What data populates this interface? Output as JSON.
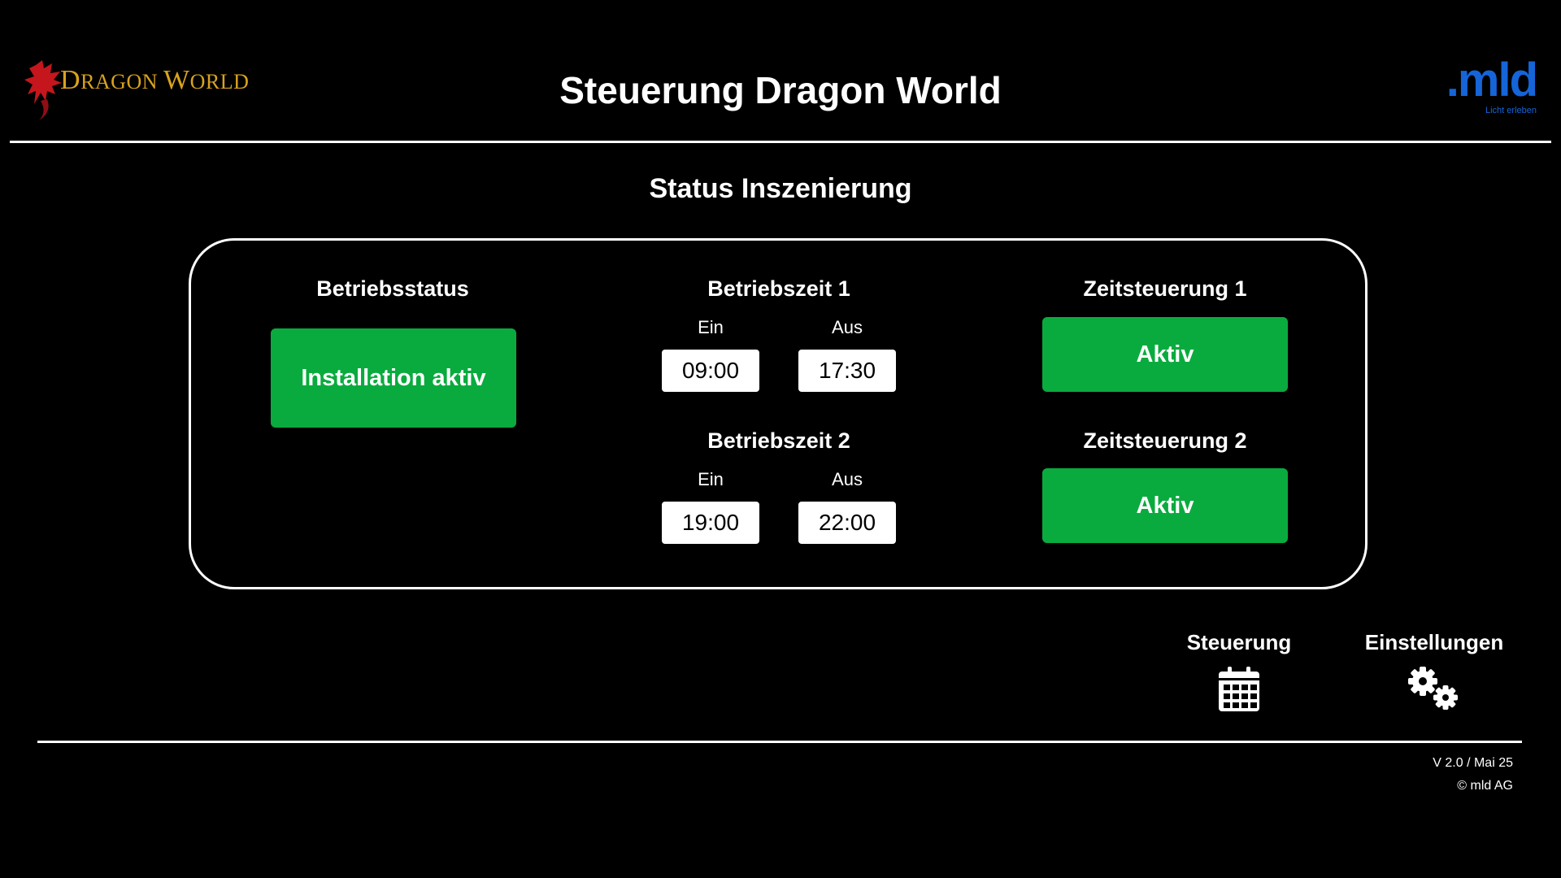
{
  "header": {
    "brand_logo": {
      "icon": "dragon-icon",
      "wordmark_first": "D",
      "wordmark_rest_1": "RAGON ",
      "wordmark_second": "W",
      "wordmark_rest_2": "ORLD"
    },
    "title": "Steuerung Dragon World",
    "partner_logo": {
      "mark": ".mld",
      "tagline": "Licht erleben"
    }
  },
  "section_title": "Status Inszenierung",
  "status_panel": {
    "betriebsstatus": {
      "title": "Betriebsstatus",
      "button_label": "Installation aktiv"
    },
    "betriebszeit_1": {
      "title": "Betriebszeit 1",
      "on_label": "Ein",
      "off_label": "Aus",
      "on_value": "09:00",
      "off_value": "17:30"
    },
    "betriebszeit_2": {
      "title": "Betriebszeit 2",
      "on_label": "Ein",
      "off_label": "Aus",
      "on_value": "19:00",
      "off_value": "22:00"
    },
    "zeitsteuerung_1": {
      "title": "Zeitsteuerung 1",
      "button_label": "Aktiv"
    },
    "zeitsteuerung_2": {
      "title": "Zeitsteuerung 2",
      "button_label": "Aktiv"
    }
  },
  "nav": {
    "steuerung": {
      "label": "Steuerung",
      "icon": "calendar-icon"
    },
    "einstellungen": {
      "label": "Einstellungen",
      "icon": "gears-icon"
    }
  },
  "footer": {
    "version": "V 2.0 / Mai 25",
    "copyright": "© mld AG"
  },
  "colors": {
    "background": "#000000",
    "accent_green": "#0aab3e",
    "brand_gold": "#d8a21e",
    "partner_blue": "#1565d8",
    "dragon_red": "#c4161c"
  }
}
